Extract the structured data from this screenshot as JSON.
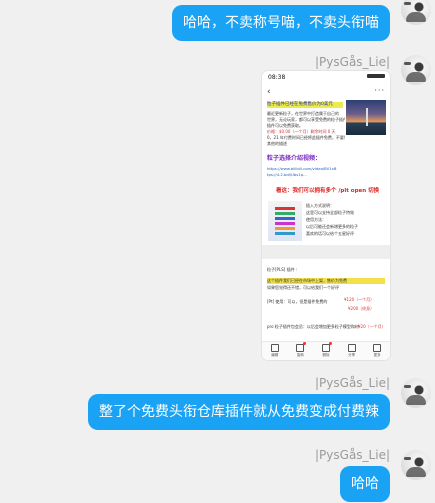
{
  "messages": [
    {
      "text": "哈哈，不卖称号喵，不卖头衔喵",
      "side": "right"
    },
    {
      "sender": "|PysGås_Lie|",
      "type": "image"
    },
    {
      "sender": "|PysGås_Lie|",
      "text": "整了个免费头衔仓库插件就从免费变成付费辣",
      "side": "right"
    },
    {
      "sender": "|PysGås_Lie|",
      "text": "哈哈",
      "side": "right"
    }
  ],
  "shot": {
    "status_time": "08:38",
    "title_line": "粒子插件已经在免费售价为0美元",
    "body_lines": [
      "最近更新粒子，在世界中打造属于自己的",
      "世界，无论玩家，都可以享受免费的粒子插件。",
      "插件可以免费获取。",
      "价格：$0.00（一个月）剩余时间 0 天",
      "0，21 年付费时间已经将此插件免费，不要看",
      "其他的描述"
    ],
    "purple_title": "粒子选择介绍视频：",
    "link_lines": [
      "https://www.bilibili.com/video/BV1xB",
      "tps://4.2.bdl/Ubs1p..."
    ],
    "red_title": "看这：我们可以拥有多个 /plt open 切换",
    "thumb_text": [
      "插入方式说明：",
      "这里可以支持全部粒子特效",
      "使用方法：",
      "以后可能还会新增更多的粒子",
      "喜欢的话可以给个五星好评"
    ],
    "lower_title": "粒子[PLS] 插件 :",
    "lower_lines": [
      "这个插件我们已经在市场中上架，售价为免费",
      "如果您觉得还不错，可以给我们一个好评"
    ],
    "price_line": "[Pt] 使用：可以，但是插件免费的",
    "price_a": "¥120（一个月）",
    "price_b": "¥200（终身）",
    "footer_line": "pro 粒子插件包会员：以后会增加更多粒子模型和材质",
    "price_c": "¥20（一个月）",
    "toolbar": [
      "编辑",
      "旋转",
      "删除",
      "分享",
      "更多"
    ]
  },
  "colors": {
    "bubble": "#1aa2f4",
    "background": "#f0f0f0",
    "name": "#9a9a9a"
  },
  "icons": [
    "avatar",
    "back-arrow-icon",
    "more-icon",
    "edit-icon",
    "rotate-icon",
    "delete-icon",
    "share-icon",
    "more-options-icon"
  ]
}
